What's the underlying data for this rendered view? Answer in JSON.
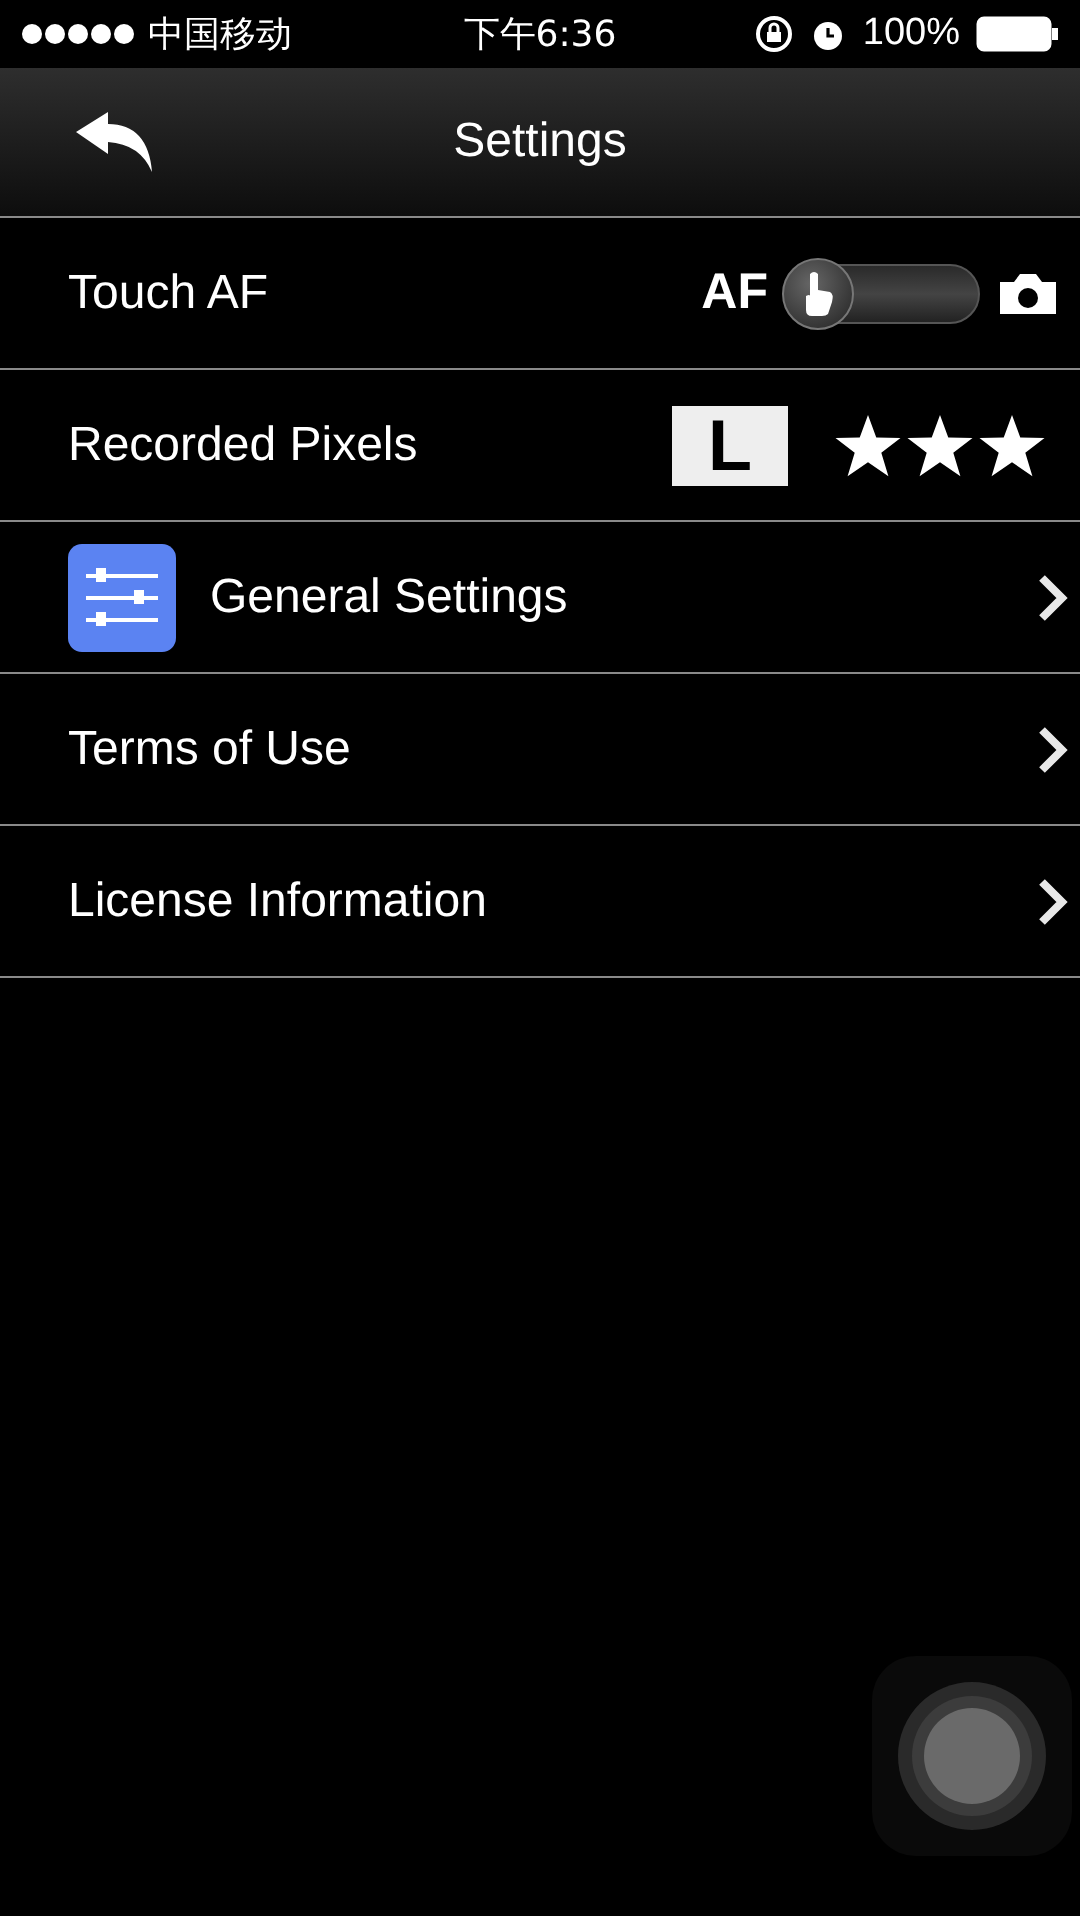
{
  "status_bar": {
    "carrier": "中国移动",
    "time": "下午6:36",
    "battery": "100%"
  },
  "nav_bar": {
    "title": "Settings"
  },
  "rows": [
    {
      "kind": "toggle",
      "label": "Touch AF",
      "left_label": "AF",
      "on": false
    },
    {
      "kind": "pixels",
      "label": "Recorded Pixels",
      "size": "L",
      "stars": 3
    },
    {
      "kind": "link",
      "label": "General Settings",
      "icon": true
    },
    {
      "kind": "link",
      "label": "Terms of Use",
      "icon": false
    },
    {
      "kind": "link",
      "label": "License Information",
      "icon": false
    }
  ]
}
